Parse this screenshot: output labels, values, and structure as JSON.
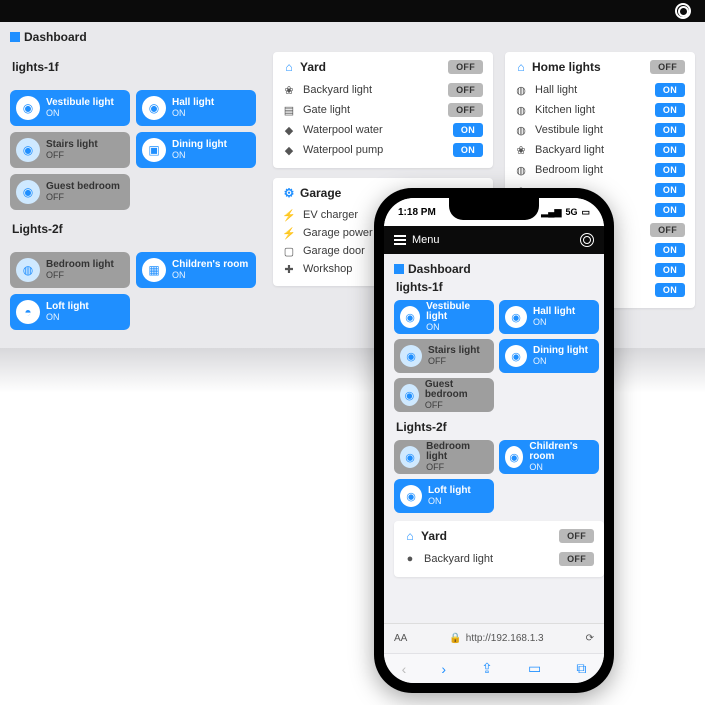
{
  "header": {
    "logo_name": "app-logo"
  },
  "dashboard_title": "Dashboard",
  "sections": {
    "lights1f_title": "lights-1f",
    "lights2f_title": "Lights-2f"
  },
  "tiles_1f": [
    {
      "name": "Vestibule light",
      "state": "ON",
      "on": true,
      "icon": "bulb"
    },
    {
      "name": "Hall light",
      "state": "ON",
      "on": true,
      "icon": "bulb"
    },
    {
      "name": "Stairs light",
      "state": "OFF",
      "on": false,
      "icon": "bulb"
    },
    {
      "name": "Dining light",
      "state": "ON",
      "on": true,
      "icon": "plate"
    },
    {
      "name": "Guest bedroom",
      "state": "OFF",
      "on": false,
      "icon": "bulb"
    }
  ],
  "tiles_2f": [
    {
      "name": "Bedroom light",
      "state": "OFF",
      "on": false,
      "icon": "lamp"
    },
    {
      "name": "Children's room",
      "state": "ON",
      "on": true,
      "icon": "toy"
    },
    {
      "name": "Loft light",
      "state": "ON",
      "on": true,
      "icon": "ceil"
    }
  ],
  "yard": {
    "title": "Yard",
    "head_state": "OFF",
    "rows": [
      {
        "label": "Backyard light",
        "state": "OFF",
        "icon": "tree"
      },
      {
        "label": "Gate light",
        "state": "OFF",
        "icon": "gate"
      },
      {
        "label": "Waterpool water",
        "state": "ON",
        "icon": "drop"
      },
      {
        "label": "Waterpool pump",
        "state": "ON",
        "icon": "drop"
      }
    ]
  },
  "garage": {
    "title": "Garage",
    "rows": [
      {
        "label": "EV charger",
        "icon": "plug"
      },
      {
        "label": "Garage power",
        "icon": "bolt"
      },
      {
        "label": "Garage door",
        "icon": "door"
      },
      {
        "label": "Workshop",
        "icon": "tool"
      }
    ]
  },
  "home_lights": {
    "title": "Home lights",
    "head_state": "OFF",
    "rows": [
      {
        "label": "Hall light",
        "state": "ON",
        "icon": "lamp"
      },
      {
        "label": "Kitchen light",
        "state": "ON",
        "icon": "lamp"
      },
      {
        "label": "Vestibule light",
        "state": "ON",
        "icon": "lamp"
      },
      {
        "label": "Backyard light",
        "state": "ON",
        "icon": "tree"
      },
      {
        "label": "Bedroom light",
        "state": "ON",
        "icon": "lamp"
      },
      {
        "label": "",
        "state": "ON",
        "icon": ""
      },
      {
        "label": "",
        "state": "ON",
        "icon": ""
      },
      {
        "label": "",
        "state": "OFF",
        "icon": ""
      },
      {
        "label": "",
        "state": "ON",
        "icon": ""
      },
      {
        "label": "",
        "state": "ON",
        "icon": ""
      },
      {
        "label": "",
        "state": "ON",
        "icon": ""
      }
    ]
  },
  "phone": {
    "time": "1:18 PM",
    "signal": "5G",
    "menu_label": "Menu",
    "dashboard_title": "Dashboard",
    "lights1f_title": "lights-1f",
    "lights2f_title": "Lights-2f",
    "tiles_1f": [
      {
        "name": "Vestibule light",
        "state": "ON",
        "on": true
      },
      {
        "name": "Hall light",
        "state": "ON",
        "on": true
      },
      {
        "name": "Stairs light",
        "state": "OFF",
        "on": false
      },
      {
        "name": "Dining light",
        "state": "ON",
        "on": true
      },
      {
        "name": "Guest bedroom",
        "state": "OFF",
        "on": false
      }
    ],
    "tiles_2f": [
      {
        "name": "Bedroom light",
        "state": "OFF",
        "on": false
      },
      {
        "name": "Children's room",
        "state": "ON",
        "on": true
      },
      {
        "name": "Loft light",
        "state": "ON",
        "on": true
      }
    ],
    "yard": {
      "title": "Yard",
      "head_state": "OFF",
      "rows": [
        {
          "label": "Backyard light",
          "state": "OFF"
        }
      ]
    },
    "address_aa": "AA",
    "address_url": "http://192.168.1.3",
    "toolbar_icons": [
      "back",
      "forward",
      "share",
      "bookmarks",
      "tabs"
    ]
  }
}
